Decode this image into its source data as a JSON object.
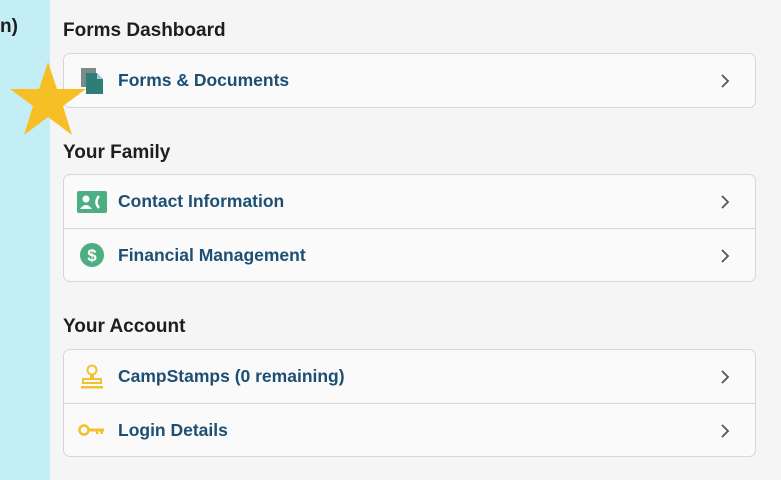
{
  "left_fragment": "n)",
  "sections": [
    {
      "title": "Forms Dashboard",
      "items": [
        {
          "label": "Forms & Documents",
          "icon": "document-icon"
        }
      ]
    },
    {
      "title": "Your Family",
      "items": [
        {
          "label": "Contact Information",
          "icon": "contact-card-icon"
        },
        {
          "label": "Financial Management",
          "icon": "dollar-icon"
        }
      ]
    },
    {
      "title": "Your Account",
      "items": [
        {
          "label": "CampStamps (0 remaining)",
          "icon": "stamp-icon"
        },
        {
          "label": "Login Details",
          "icon": "key-icon"
        }
      ]
    }
  ],
  "colors": {
    "background": "#c4eef6",
    "panel": "#f5f5f5",
    "link_text": "#1d4f74",
    "teal_icon": "#2f7d78",
    "green_icon": "#4cae82",
    "yellow_icon": "#f2c12e",
    "star": "#f6bf26"
  }
}
